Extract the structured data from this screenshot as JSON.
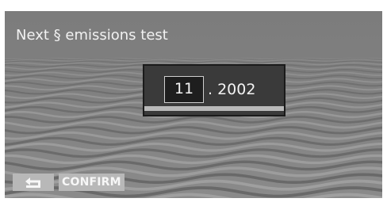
{
  "screen": {
    "title": "Next § emissions test"
  },
  "date_input": {
    "month": "11",
    "year_text": ". 2002"
  },
  "buttons": {
    "back_icon": "return-arrow-icon",
    "confirm_label": "CONFIRM"
  },
  "colors": {
    "screen_background": "#7f7f7f",
    "panel_background": "#3a3a3a",
    "button_background": "#b8b8b8",
    "text": "#f2f2f2"
  }
}
